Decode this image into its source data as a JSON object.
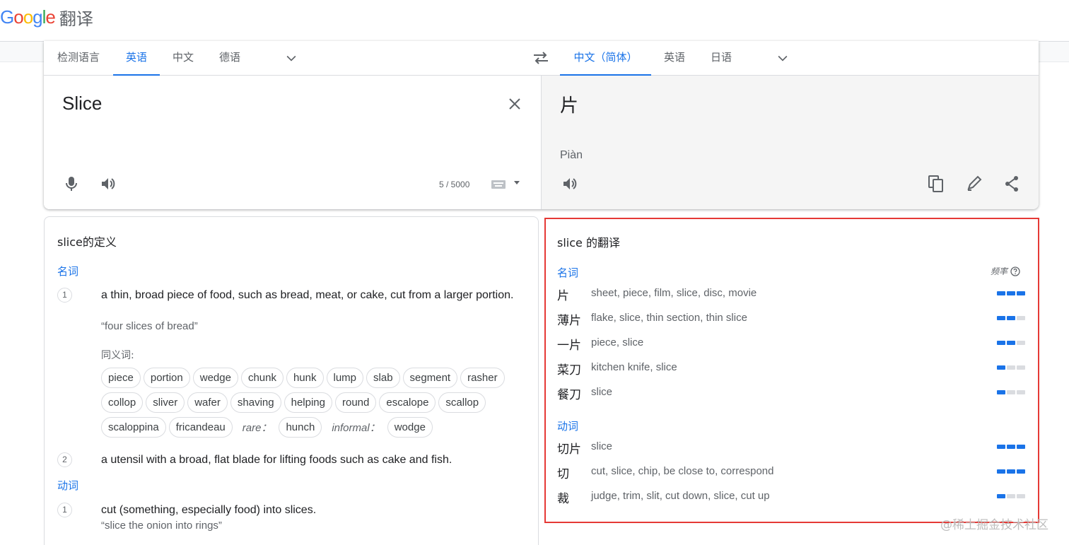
{
  "header": {
    "logo_text": "Google",
    "logo_letters": [
      {
        "ch": "G",
        "color": "#4285f4"
      },
      {
        "ch": "o",
        "color": "#ea4335"
      },
      {
        "ch": "o",
        "color": "#fbbc05"
      },
      {
        "ch": "g",
        "color": "#4285f4"
      },
      {
        "ch": "l",
        "color": "#34a853"
      },
      {
        "ch": "e",
        "color": "#ea4335"
      }
    ],
    "product": "翻译"
  },
  "source_langs": {
    "tabs": [
      "检测语言",
      "英语",
      "中文",
      "德语"
    ],
    "active": "英语",
    "more_icon": "chevron-down-icon"
  },
  "swap_icon": "swap-icon",
  "target_langs": {
    "tabs": [
      "中文（简体）",
      "英语",
      "日语"
    ],
    "active": "中文（简体）",
    "more_icon": "chevron-down-icon"
  },
  "source": {
    "text": "Slice",
    "char_count": "5 / 5000",
    "icons": [
      "close-icon",
      "microphone-icon",
      "speaker-icon",
      "keyboard-icon"
    ]
  },
  "target": {
    "text": "片",
    "pinyin": "Piàn",
    "icons": [
      "speaker-icon",
      "copy-icon",
      "edit-icon",
      "share-icon"
    ]
  },
  "definitions": {
    "title": "slice的定义",
    "noun_label": "名词",
    "noun_defs": [
      {
        "num": "1",
        "text": "a thin, broad piece of food, such as bread, meat, or cake, cut from a larger portion.",
        "example": "“four slices of bread”"
      },
      {
        "num": "2",
        "text": "a utensil with a broad, flat blade for lifting foods such as cake and fish."
      }
    ],
    "synonyms_label": "同义词:",
    "synonyms_row1": [
      "piece",
      "portion",
      "wedge",
      "chunk",
      "hunk",
      "lump",
      "slab",
      "segment",
      "rasher"
    ],
    "synonyms_row2": [
      "collop",
      "sliver",
      "wafer",
      "shaving",
      "helping",
      "round",
      "escalope",
      "scallop"
    ],
    "synonyms_row3": [
      "scaloppina",
      "fricandeau"
    ],
    "rare_label": "rare：",
    "rare_words": [
      "hunch"
    ],
    "informal_label": "informal：",
    "informal_words": [
      "wodge"
    ],
    "verb_label": "动词",
    "verb_defs": [
      {
        "num": "1",
        "text": "cut (something, especially food) into slices.",
        "example": "“slice the onion into rings”"
      }
    ]
  },
  "translations": {
    "title": "slice 的翻译",
    "frequency_label": "频率",
    "help_icon": "help-circle-icon",
    "noun_label": "名词",
    "nouns": [
      {
        "word": "片",
        "synonyms": "sheet, piece, film, slice, disc, movie",
        "frequency": 3
      },
      {
        "word": "薄片",
        "synonyms": "flake, slice, thin section, thin slice",
        "frequency": 2
      },
      {
        "word": "一片",
        "synonyms": "piece, slice",
        "frequency": 2
      },
      {
        "word": "菜刀",
        "synonyms": "kitchen knife, slice",
        "frequency": 1
      },
      {
        "word": "餐刀",
        "synonyms": "slice",
        "frequency": 1
      }
    ],
    "verb_label": "动词",
    "verbs": [
      {
        "word": "切片",
        "synonyms": "slice",
        "frequency": 3
      },
      {
        "word": "切",
        "synonyms": "cut, slice, chip, be close to, correspond",
        "frequency": 3
      },
      {
        "word": "裁",
        "synonyms": "judge, trim, slit, cut down, slice, cut up",
        "frequency": 1
      }
    ],
    "highlight_color": "#e53935"
  },
  "watermark": "@稀土掘金技术社区",
  "colors": {
    "accent": "#1a73e8",
    "text": "#202124",
    "muted": "#5f6368",
    "border": "#dadce0"
  }
}
